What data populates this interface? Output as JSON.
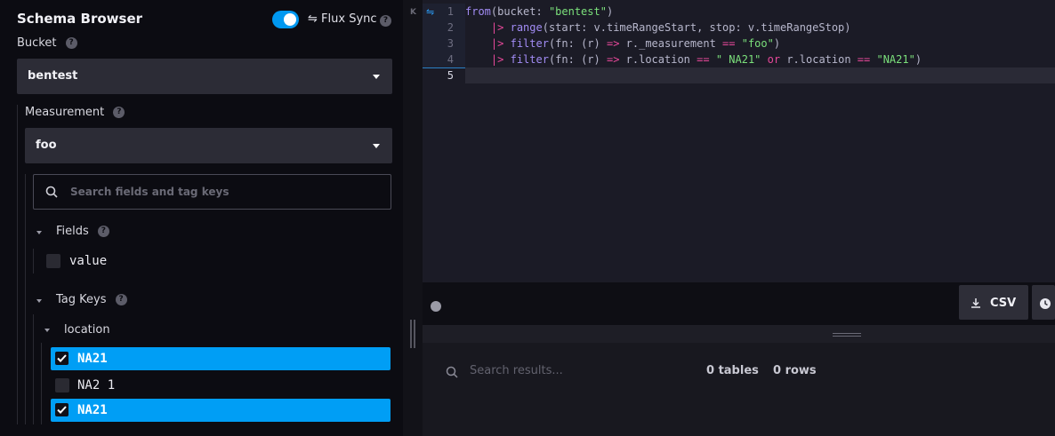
{
  "schema_browser": {
    "title": "Schema Browser",
    "flux_sync_label": "Flux Sync",
    "bucket_label": "Bucket",
    "bucket_value": "bentest",
    "measurement_label": "Measurement",
    "measurement_value": "foo",
    "search_placeholder": "Search fields and tag keys",
    "fields_label": "Fields",
    "fields": [
      "value"
    ],
    "tag_keys_label": "Tag Keys",
    "tag_key": "location",
    "tag_values": [
      {
        "label": "NA21",
        "selected": true
      },
      {
        "label": "NA2 1",
        "selected": false
      },
      {
        "label": "NA21",
        "selected": true
      }
    ]
  },
  "editor": {
    "line_numbers": [
      "1",
      "2",
      "3",
      "4",
      "5"
    ]
  },
  "toolbar": {
    "csv_label": "CSV"
  },
  "results": {
    "search_placeholder": "Search results...",
    "tables_count": "0 tables",
    "rows_count": "0 rows"
  },
  "colors": {
    "accent": "#009ef5",
    "string": "#7be07b",
    "keyword": "#e7489a",
    "function": "#a28cf5"
  }
}
